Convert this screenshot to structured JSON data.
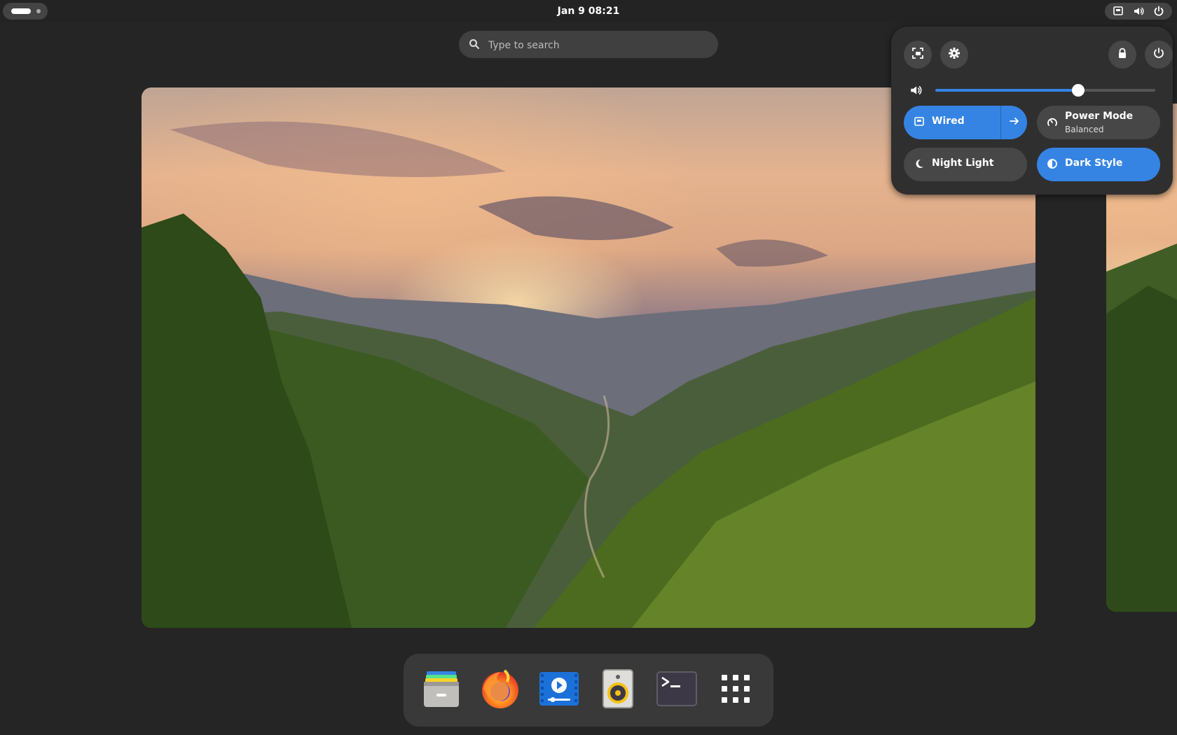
{
  "topbar": {
    "clock": "Jan 9  08:21",
    "activities_icon": "activities-indicator",
    "status_icons": [
      "network-wired-icon",
      "speaker-icon",
      "power-icon"
    ]
  },
  "search": {
    "placeholder": "Type to search",
    "icon": "search-icon"
  },
  "quick_settings": {
    "buttons": [
      "screenshot-icon",
      "gear-icon",
      "lock-icon",
      "power-icon"
    ],
    "volume": {
      "icon": "speaker-icon",
      "level": 0.65
    },
    "toggles": [
      {
        "label": "Wired",
        "icon": "network-wired-icon",
        "active": true,
        "has_arrow": true
      },
      {
        "label": "Power Mode",
        "sublabel": "Balanced",
        "icon": "speedometer-icon",
        "active": false
      },
      {
        "label": "Night Light",
        "icon": "moon-icon",
        "active": false
      },
      {
        "label": "Dark Style",
        "icon": "dark-style-icon",
        "active": true
      }
    ],
    "accent_color": "#3584e4"
  },
  "dash": {
    "apps": [
      "files-icon",
      "firefox-icon",
      "videos-icon",
      "rhythmbox-icon",
      "terminal-icon",
      "show-apps-grid-icon"
    ]
  },
  "workspaces": [
    "mountain-valley-wallpaper",
    "mountain-valley-wallpaper-next"
  ]
}
